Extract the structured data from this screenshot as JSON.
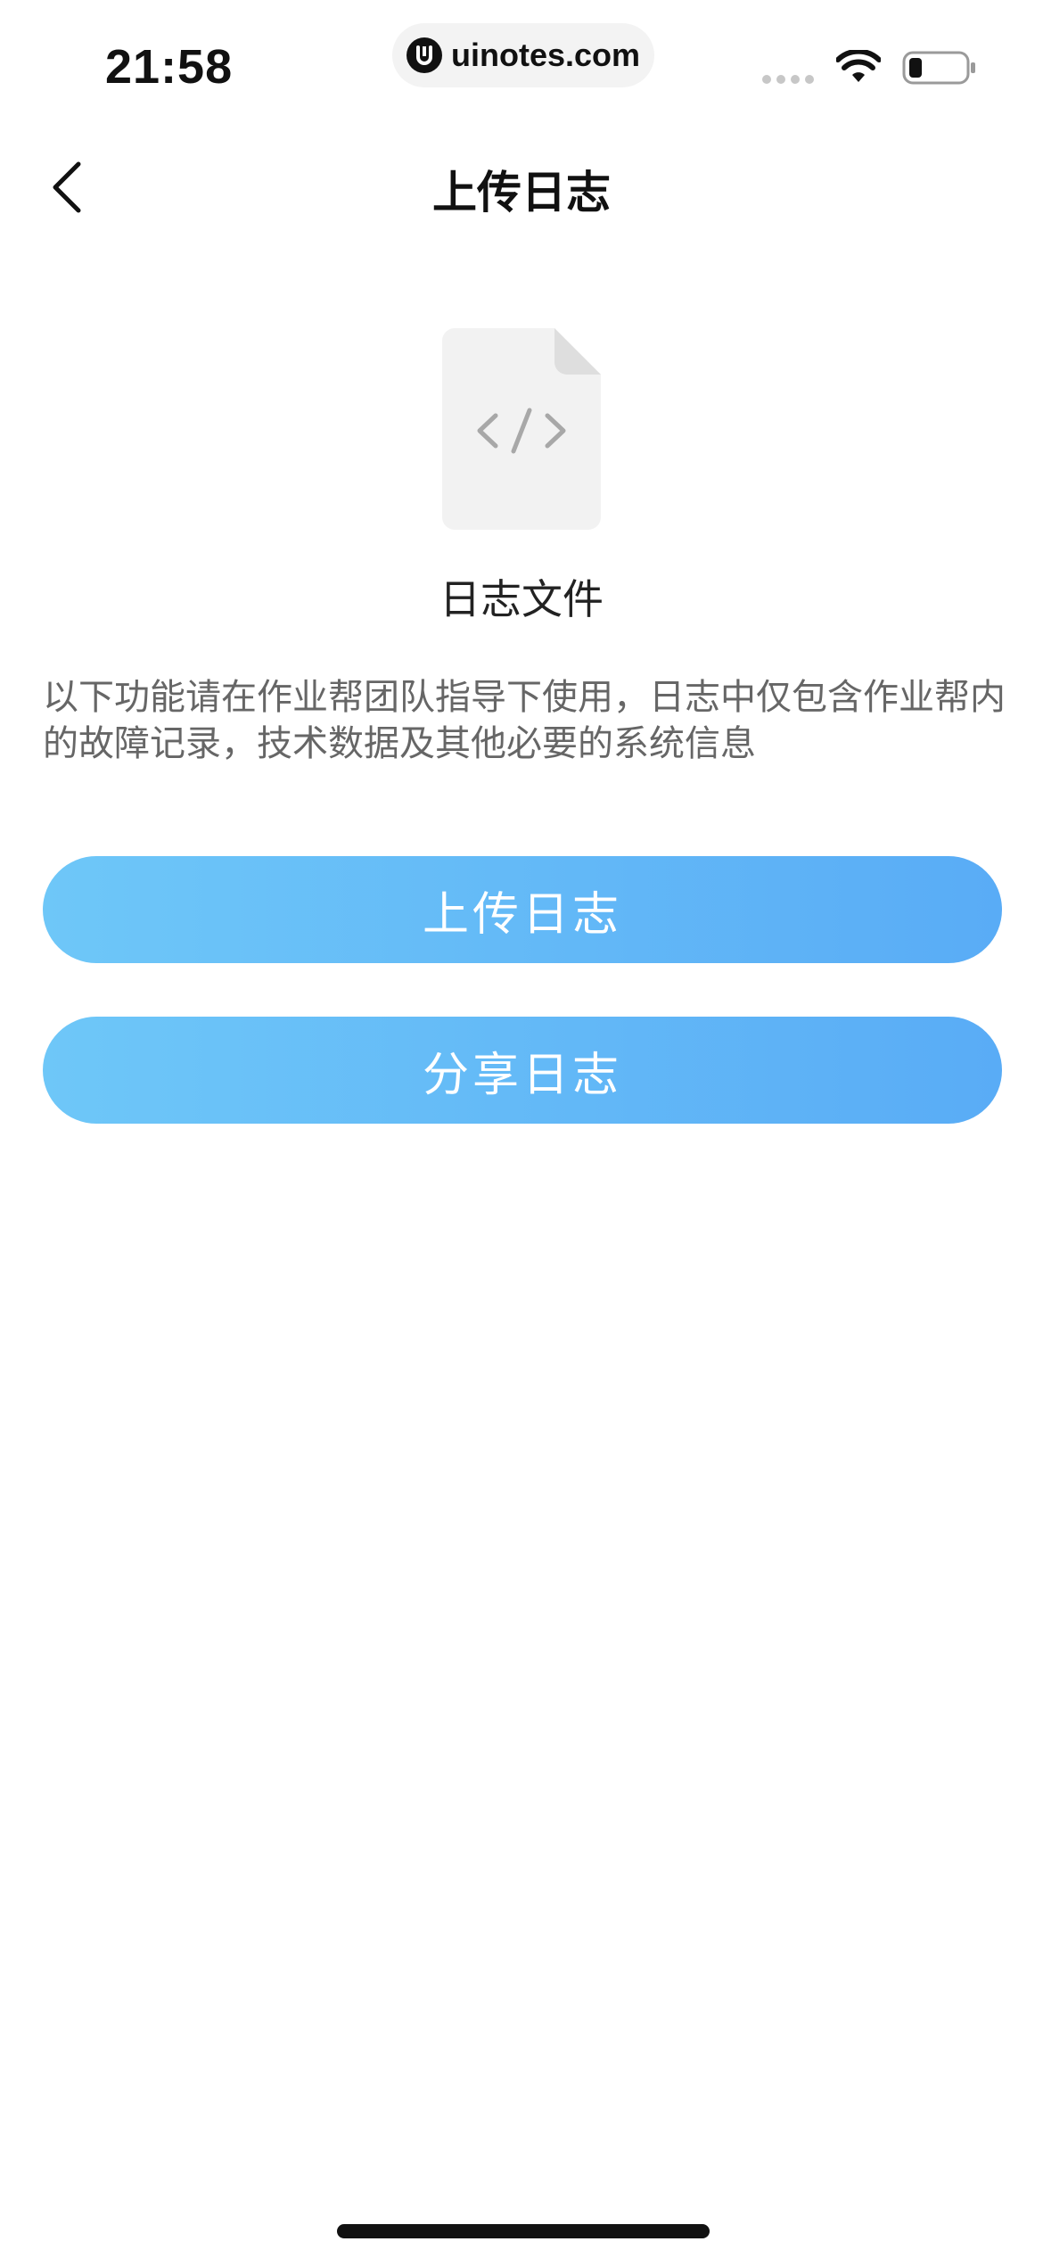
{
  "status_bar": {
    "time": "21:58",
    "url": "uinotes.com",
    "wifi_icon": "wifi-icon",
    "battery_icon": "battery-low-icon",
    "signal_icon": "signal-dots-icon"
  },
  "nav": {
    "back_icon": "chevron-left-icon",
    "title": "上传日志"
  },
  "file": {
    "icon": "code-file-icon",
    "label": "日志文件"
  },
  "description": "以下功能请在作业帮团队指导下使用，日志中仅包含作业帮内的故障记录，技术数据及其他必要的系统信息",
  "buttons": {
    "upload_label": "上传日志",
    "share_label": "分享日志"
  },
  "colors": {
    "button_gradient_start": "#6ec7f8",
    "button_gradient_end": "#59acf6",
    "description_text": "#666666",
    "file_icon_bg": "#f2f2f2"
  }
}
